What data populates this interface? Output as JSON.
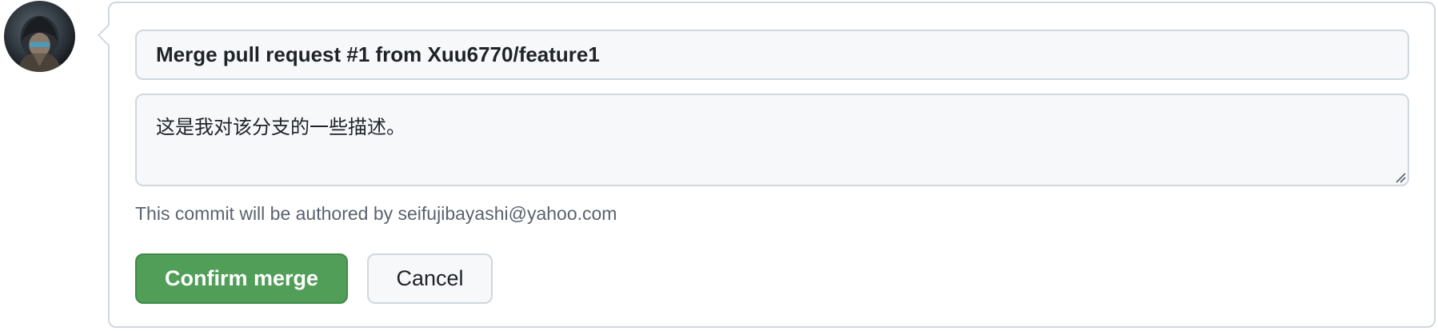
{
  "merge_form": {
    "title_value": "Merge pull request #1 from Xuu6770/feature1",
    "description_value": "这是我对该分支的一些描述。",
    "author_note": "This commit will be authored by seifujibayashi@yahoo.com",
    "confirm_label": "Confirm merge",
    "cancel_label": "Cancel"
  },
  "avatar": {
    "icon": "user-avatar"
  },
  "colors": {
    "confirm_bg": "#519e58",
    "border": "#d0d7de",
    "input_bg": "#f6f8fa",
    "muted_text": "#59636e"
  }
}
